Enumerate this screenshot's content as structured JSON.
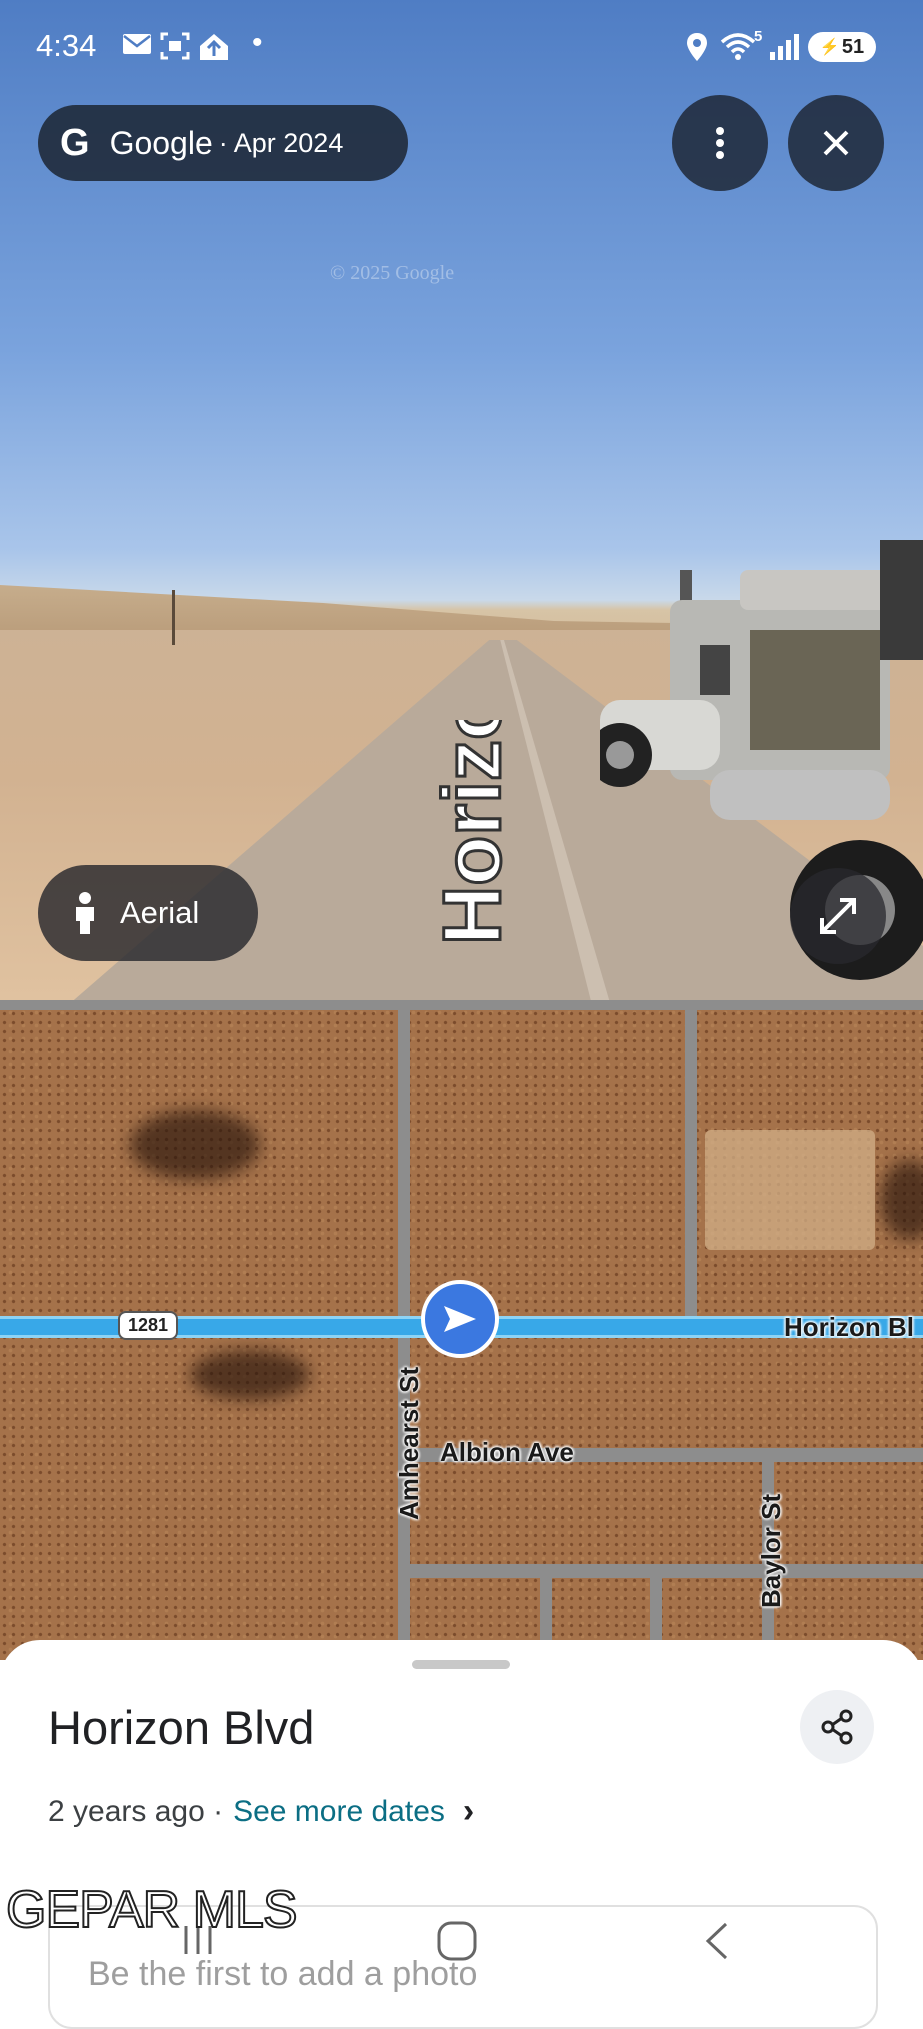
{
  "status_bar": {
    "time": "4:34",
    "wifi_badge": "5",
    "battery": "51"
  },
  "streetview": {
    "source_brand": "Google",
    "capture_date": "· Apr 2024",
    "watermark": "© 2025 Google",
    "road_label": "Horizon Blvd",
    "aerial_label": "Aerial",
    "colors": {
      "sky": "#4f7dc4",
      "overlay": "#1e2837"
    }
  },
  "map": {
    "highway_shield": "1281",
    "labels": {
      "horizon": "Horizon Bl",
      "amhearst": "Amhearst St",
      "albion": "Albion Ave",
      "baylor": "Baylor St"
    },
    "colors": {
      "highway": "#38a8e8",
      "pegman": "#3b78e0"
    }
  },
  "sheet": {
    "title": "Horizon Blvd",
    "age": "2 years ago ·",
    "see_more": "See more dates",
    "photo_prompt": "Be the first to add a photo"
  },
  "watermark_overlay": "GEPAR MLS"
}
